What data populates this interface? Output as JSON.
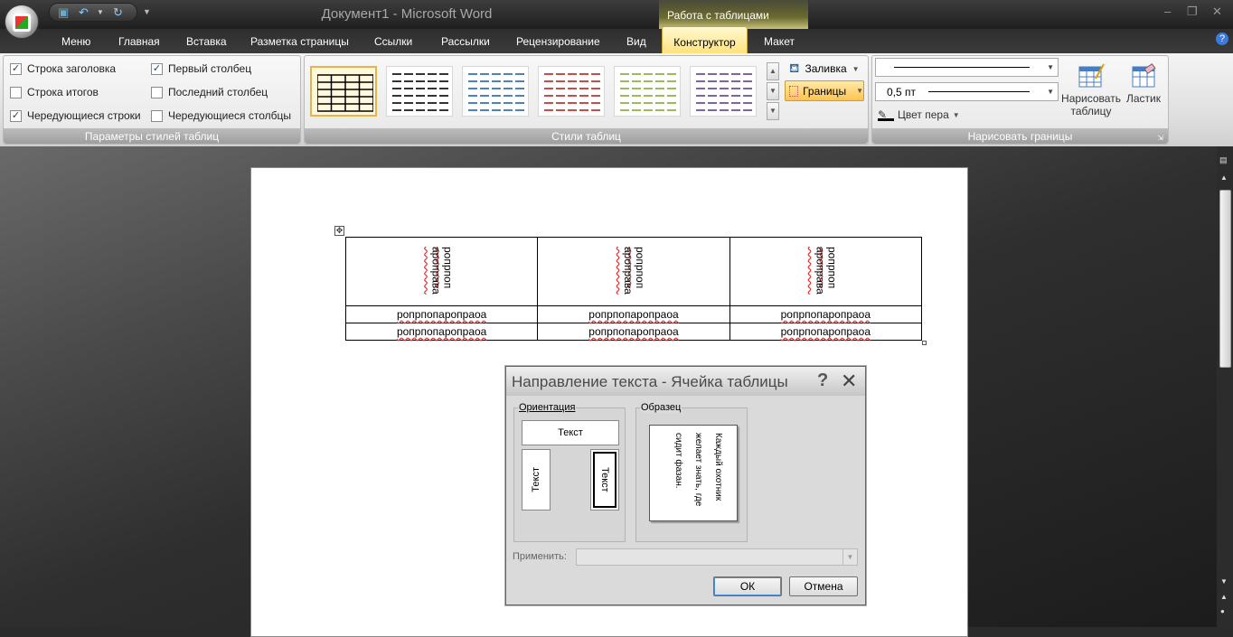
{
  "window": {
    "title": "Документ1 - Microsoft Word",
    "context_tab_title": "Работа с таблицами",
    "minimize": "–",
    "restore": "❐",
    "close": "✕"
  },
  "tabs": [
    "Меню",
    "Главная",
    "Вставка",
    "Разметка страницы",
    "Ссылки",
    "Рассылки",
    "Рецензирование",
    "Вид",
    "Конструктор",
    "Макет"
  ],
  "style_options": {
    "header_row": "Строка заголовка",
    "total_row": "Строка итогов",
    "banded_rows": "Чередующиеся строки",
    "first_column": "Первый столбец",
    "last_column": "Последний столбец",
    "banded_columns": "Чередующиеся столбцы",
    "group_label": "Параметры стилей таблиц"
  },
  "table_styles": {
    "group_label": "Стили таблиц",
    "fill": "Заливка",
    "borders": "Границы",
    "thumb_colors": [
      "#000000",
      "#333333",
      "#4f81bd",
      "#c0504d",
      "#9bbb59",
      "#8064a2"
    ]
  },
  "draw_borders": {
    "pen_weight": "0,5 пт",
    "pen_color": "Цвет пера",
    "draw_table_1": "Нарисовать",
    "draw_table_2": "таблицу",
    "eraser": "Ластик",
    "group_label": "Нарисовать границы"
  },
  "document_table": {
    "header_lines": [
      "ропрпоп",
      "ароправа"
    ],
    "rows": [
      [
        "ропрпопаропраоа",
        "ропрпопаропраоа",
        "ропрпопаропраоа"
      ],
      [
        "ропрпопаропраоа",
        "ропрпопаропраоа",
        "ропрпопаропраоа"
      ]
    ]
  },
  "dialog": {
    "title": "Направление текста - Ячейка таблицы",
    "help": "?",
    "close": "✕",
    "orientation_label": "Ориентация",
    "sample_label": "Образец",
    "orient_text": "Текст",
    "sample_text": "Каждый охотник желает знать, где сидит фазан.",
    "apply_label": "Применить:",
    "ok": "ОК",
    "cancel": "Отмена"
  }
}
